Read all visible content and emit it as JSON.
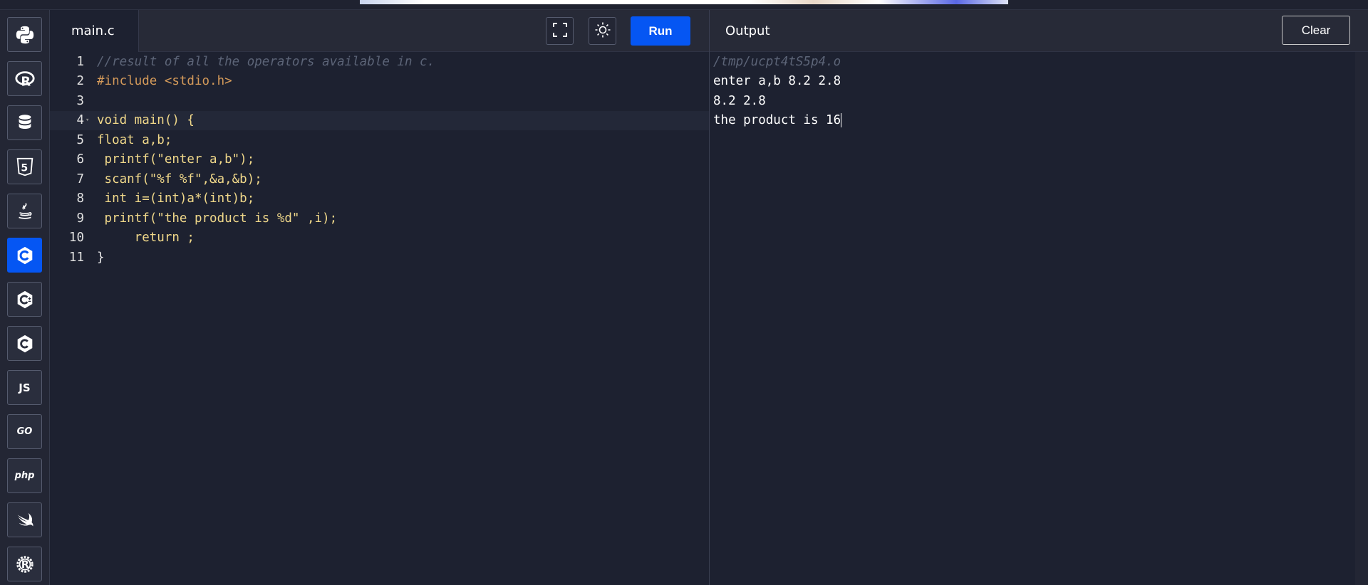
{
  "sidebar": {
    "languages": [
      {
        "name": "python",
        "icon": "python-icon"
      },
      {
        "name": "r",
        "icon": "r-icon"
      },
      {
        "name": "sql",
        "icon": "database-icon"
      },
      {
        "name": "html",
        "icon": "html5-icon"
      },
      {
        "name": "java",
        "icon": "java-icon"
      },
      {
        "name": "c",
        "icon": "c-icon",
        "active": true
      },
      {
        "name": "cpp",
        "icon": "cpp-icon"
      },
      {
        "name": "csharp",
        "icon": "csharp-icon"
      },
      {
        "name": "javascript",
        "icon": "js-icon",
        "label": "JS"
      },
      {
        "name": "go",
        "icon": "go-icon",
        "label": "GO"
      },
      {
        "name": "php",
        "icon": "php-icon",
        "label": "php"
      },
      {
        "name": "swift",
        "icon": "swift-icon"
      },
      {
        "name": "rust",
        "icon": "rust-icon"
      }
    ]
  },
  "editor": {
    "tab_label": "main.c",
    "run_label": "Run",
    "lines": [
      {
        "n": "1",
        "code": "//result of all the operators available in c."
      },
      {
        "n": "2",
        "code": "#include <stdio.h>"
      },
      {
        "n": "3",
        "code": ""
      },
      {
        "n": "4",
        "code": "void main() {"
      },
      {
        "n": "5",
        "code": "float a,b;"
      },
      {
        "n": "6",
        "code": " printf(\"enter a,b\");"
      },
      {
        "n": "7",
        "code": " scanf(\"%f %f\",&a,&b);"
      },
      {
        "n": "8",
        "code": " int i=(int)a*(int)b;"
      },
      {
        "n": "9",
        "code": " printf(\"the product is %d\" ,i);"
      },
      {
        "n": "10",
        "code": "     return ;"
      },
      {
        "n": "11",
        "code": "}"
      }
    ]
  },
  "output": {
    "title": "Output",
    "clear_label": "Clear",
    "lines": [
      "/tmp/ucpt4tS5p4.o",
      "enter a,b 8.2 2.8",
      "8.2 2.8",
      "the product is 16"
    ]
  },
  "colors": {
    "accent": "#0556f3",
    "background": "#1d2130",
    "header": "#272a37"
  }
}
